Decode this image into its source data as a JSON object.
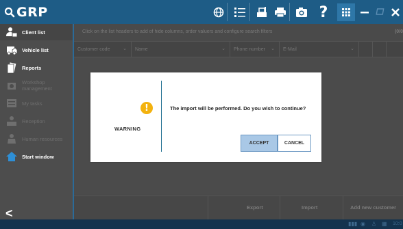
{
  "app": {
    "title": "GRP"
  },
  "topbar": {
    "icons": [
      "globe-icon",
      "list-icon",
      "print-station-icon",
      "printer-icon",
      "camera-icon",
      "help-icon",
      "grid-icon",
      "minimize-icon",
      "restore-icon",
      "close-icon"
    ],
    "help_label": "?"
  },
  "sidebar": {
    "items": [
      {
        "label": "Client list",
        "icon": "client-icon",
        "active": true
      },
      {
        "label": "Vehicle list",
        "icon": "vehicle-icon",
        "active": false
      },
      {
        "label": "Reports",
        "icon": "reports-icon",
        "active": false
      },
      {
        "label": "Workshop management",
        "icon": "workshop-icon",
        "active": false
      },
      {
        "label": "My tasks",
        "icon": "tasks-icon",
        "active": false
      },
      {
        "label": "Reception",
        "icon": "reception-icon",
        "active": false
      },
      {
        "label": "Human resources",
        "icon": "hr-icon",
        "active": false
      },
      {
        "label": "Start window",
        "icon": "home-icon",
        "active": false
      }
    ],
    "back_label": "<"
  },
  "main": {
    "hint": "Click on the list headers to add of hide columns, order valuers and configure search filters",
    "count": "(0/0",
    "columns": [
      "Customer code",
      "Name",
      "Phone number",
      "E-Mail"
    ],
    "footer": {
      "export": "Export",
      "import": "Import",
      "add": "Add new customer"
    }
  },
  "dialog": {
    "warning_label": "WARNING",
    "warning_symbol": "!",
    "message": "The import will be performed. Do you wish to continue?",
    "accept": "ACCEPT",
    "cancel": "CANCEL"
  },
  "statusbar": {
    "time": "10:0"
  },
  "colors": {
    "topbar": "#1e5c86",
    "sidebar": "#4d4d4d",
    "accent": "#2b6b99",
    "warning": "#f3b20f",
    "accept_bg": "#a9c8e6"
  }
}
